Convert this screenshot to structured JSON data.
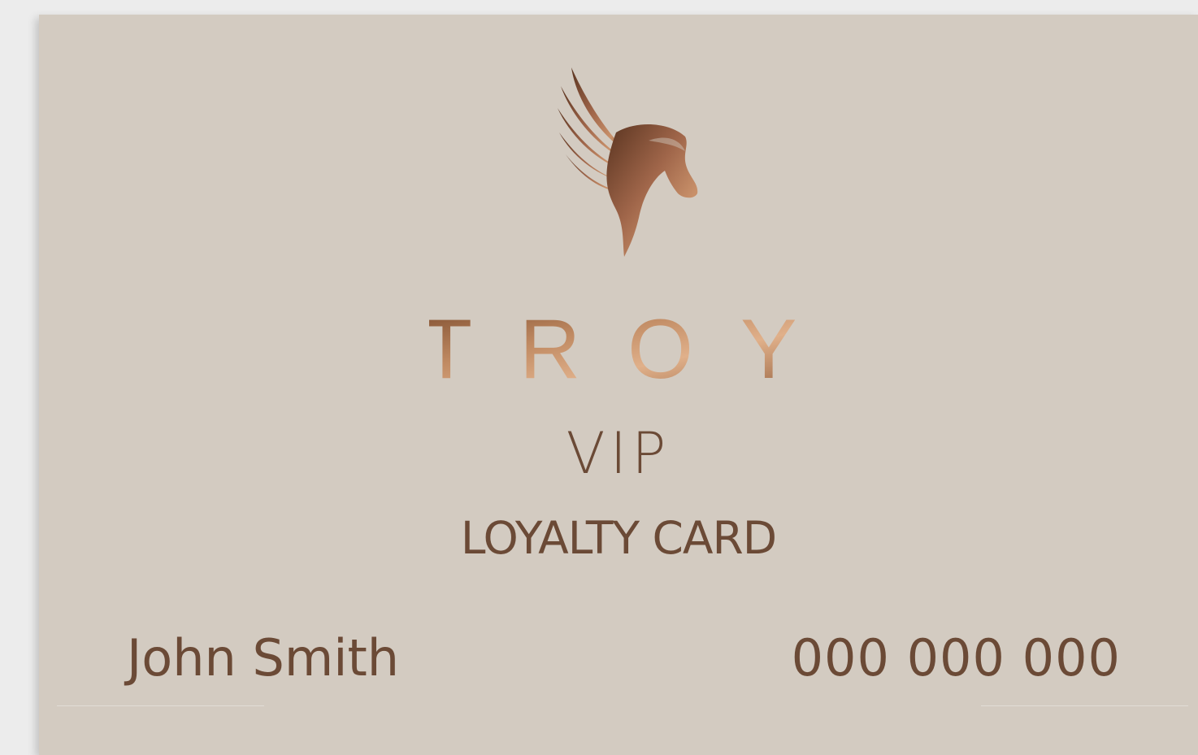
{
  "card": {
    "brand": "TROY",
    "tier": "VIP",
    "card_type": "LOYALTY CARD",
    "holder_name": "John Smith",
    "card_number": "000 000 000",
    "logo_icon": "pegasus-icon"
  },
  "colors": {
    "card_background": "#d3cbc1",
    "text": "#6b4a36",
    "copper_light": "#c08a62",
    "copper_dark": "#7a4a2c"
  }
}
